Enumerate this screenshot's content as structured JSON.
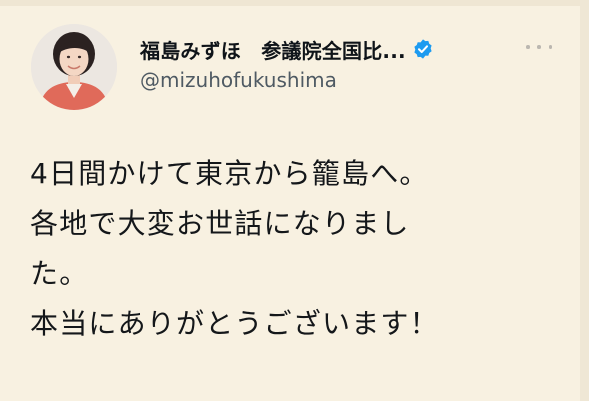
{
  "tweet": {
    "author": {
      "display_name": "福島みずほ　参議院全国比...",
      "handle": "@mizuhofukushima",
      "verified_icon": "verified-badge-icon",
      "avatar_icon": "profile-photo"
    },
    "more_icon": "more-options-icon",
    "text_lines": [
      "4日間かけて東京から籠島へ。",
      "各地で大変お世話になりまし",
      "た。",
      "本当にありがとうございます！"
    ]
  },
  "colors": {
    "background": "#f8f1e1",
    "verified": "#1d9bf0",
    "text": "#14171a",
    "handle": "#4f5a63"
  }
}
